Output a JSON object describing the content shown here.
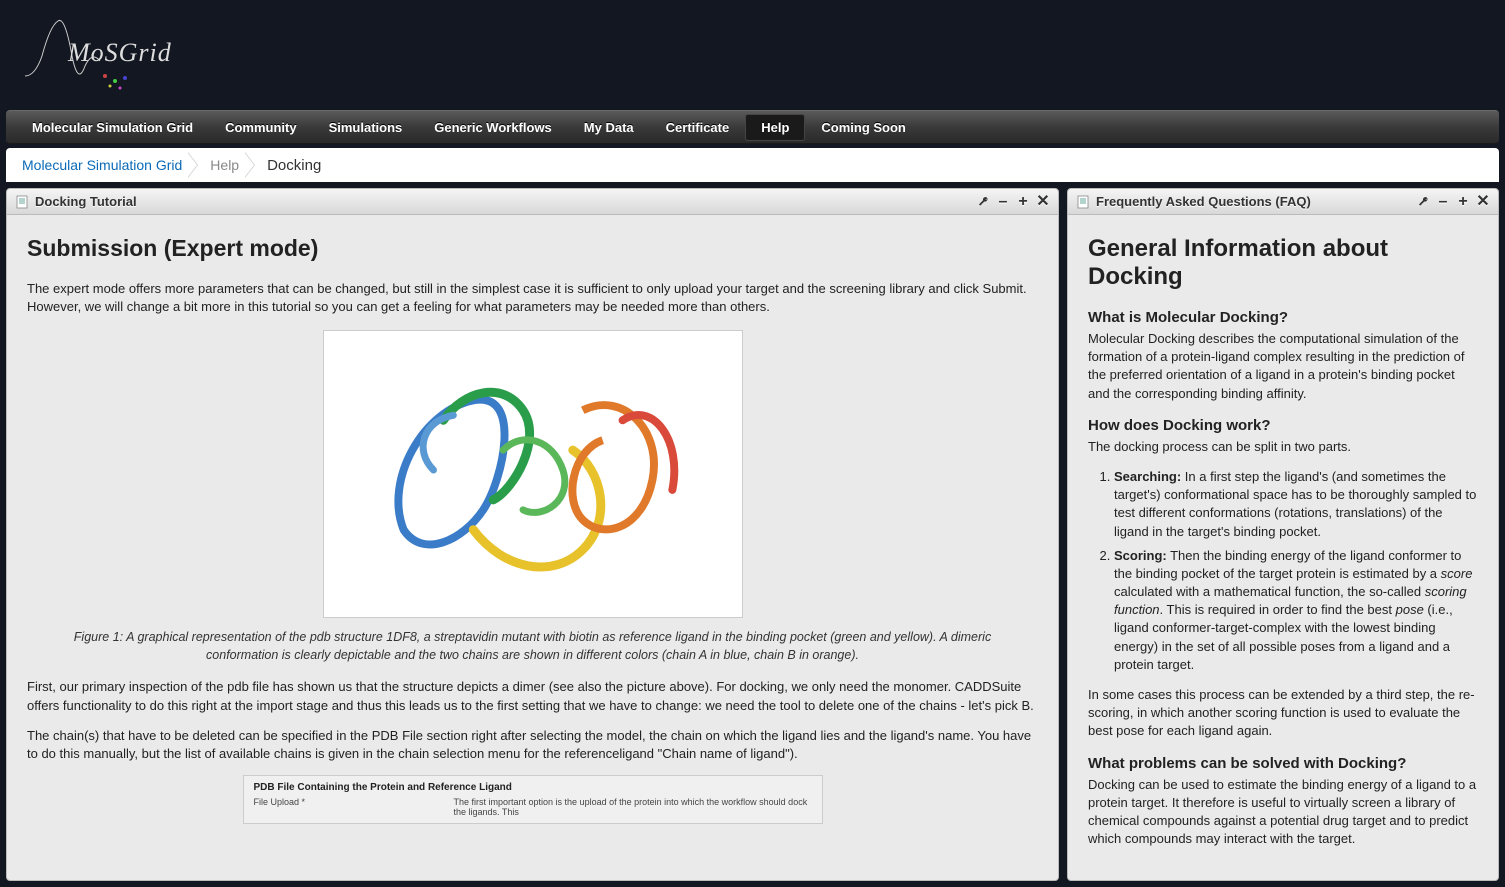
{
  "logo_text": "MoSGrid",
  "nav": {
    "items": [
      "Molecular Simulation Grid",
      "Community",
      "Simulations",
      "Generic Workflows",
      "My Data",
      "Certificate",
      "Help",
      "Coming Soon"
    ],
    "active_index": 6
  },
  "breadcrumb": {
    "root": "Molecular Simulation Grid",
    "mid": "Help",
    "current": "Docking"
  },
  "left_panel": {
    "title": "Docking Tutorial",
    "heading": "Submission (Expert mode)",
    "p1": "The expert mode offers more parameters that can be changed, but still in the simplest case it is sufficient to only upload your target and the screening library and click Submit. However, we will change a bit more in this tutorial so you can get a feeling for what parameters may be needed more than others.",
    "figure_caption": "Figure 1: A graphical representation of the pdb structure 1DF8, a streptavidin mutant with biotin as reference ligand in the binding pocket (green and yellow). A dimeric conformation is clearly depictable and the two chains are shown in different colors (chain A in blue, chain B in orange).",
    "p2": "First, our primary inspection of the pdb file has shown us that the structure depicts a dimer (see also the picture above). For docking, we only need the monomer. CADDSuite offers functionality to do this right at the import stage and thus this leads us to the first setting that we have to change: we need the tool to delete one of the chains - let's pick B.",
    "p3": "The chain(s) that have to be deleted can be specified in the PDB File section right after selecting the model, the chain on which the ligand lies and the ligand's name. You have to do this manually, but the list of available chains is given in the chain selection menu for the referenceligand \"Chain name of ligand\").",
    "subbox": {
      "title": "PDB File Containing the Protein and Reference Ligand",
      "left": "File Upload *",
      "right": "The first important option is the upload of the protein into which the workflow should dock the ligands. This"
    }
  },
  "right_panel": {
    "title": "Frequently Asked Questions (FAQ)",
    "heading": "General Information about Docking",
    "q1": "What is Molecular Docking?",
    "a1": "Molecular Docking describes the computational simulation of the formation of a protein-ligand complex resulting in the prediction of the preferred orientation of a ligand in a protein's binding pocket and the corresponding binding affinity.",
    "q2": "How does Docking work?",
    "a2_intro": "The docking process can be split in two parts.",
    "li1_label": "Searching:",
    "li1_text": " In a first step the ligand's (and sometimes the target's) conformational space has to be thoroughly sampled to test different conformations (rotations, translations) of the ligand in the target's binding pocket.",
    "li2_label": "Scoring:",
    "li2_text_a": " Then the binding energy of the ligand conformer to the binding pocket of the target protein is estimated by a ",
    "li2_em1": "score",
    "li2_text_b": " calculated with a mathematical function, the so-called ",
    "li2_em2": "scoring function",
    "li2_text_c": ". This is required in order to find the best ",
    "li2_em3": "pose",
    "li2_text_d": " (i.e., ligand conformer-target-complex with the lowest binding energy) in the set of all possible poses from a ligand and a protein target.",
    "a2_extra": "In some cases this process can be extended by a third step, the re-scoring, in which another scoring function is used to evaluate the best pose for each ligand again.",
    "q3": "What problems can be solved with Docking?",
    "a3": "Docking can be used to estimate the binding energy of a ligand to a protein target. It therefore is useful to virtually screen a library of chemical compounds against a potential drug target and to predict which compounds may interact with the target."
  }
}
